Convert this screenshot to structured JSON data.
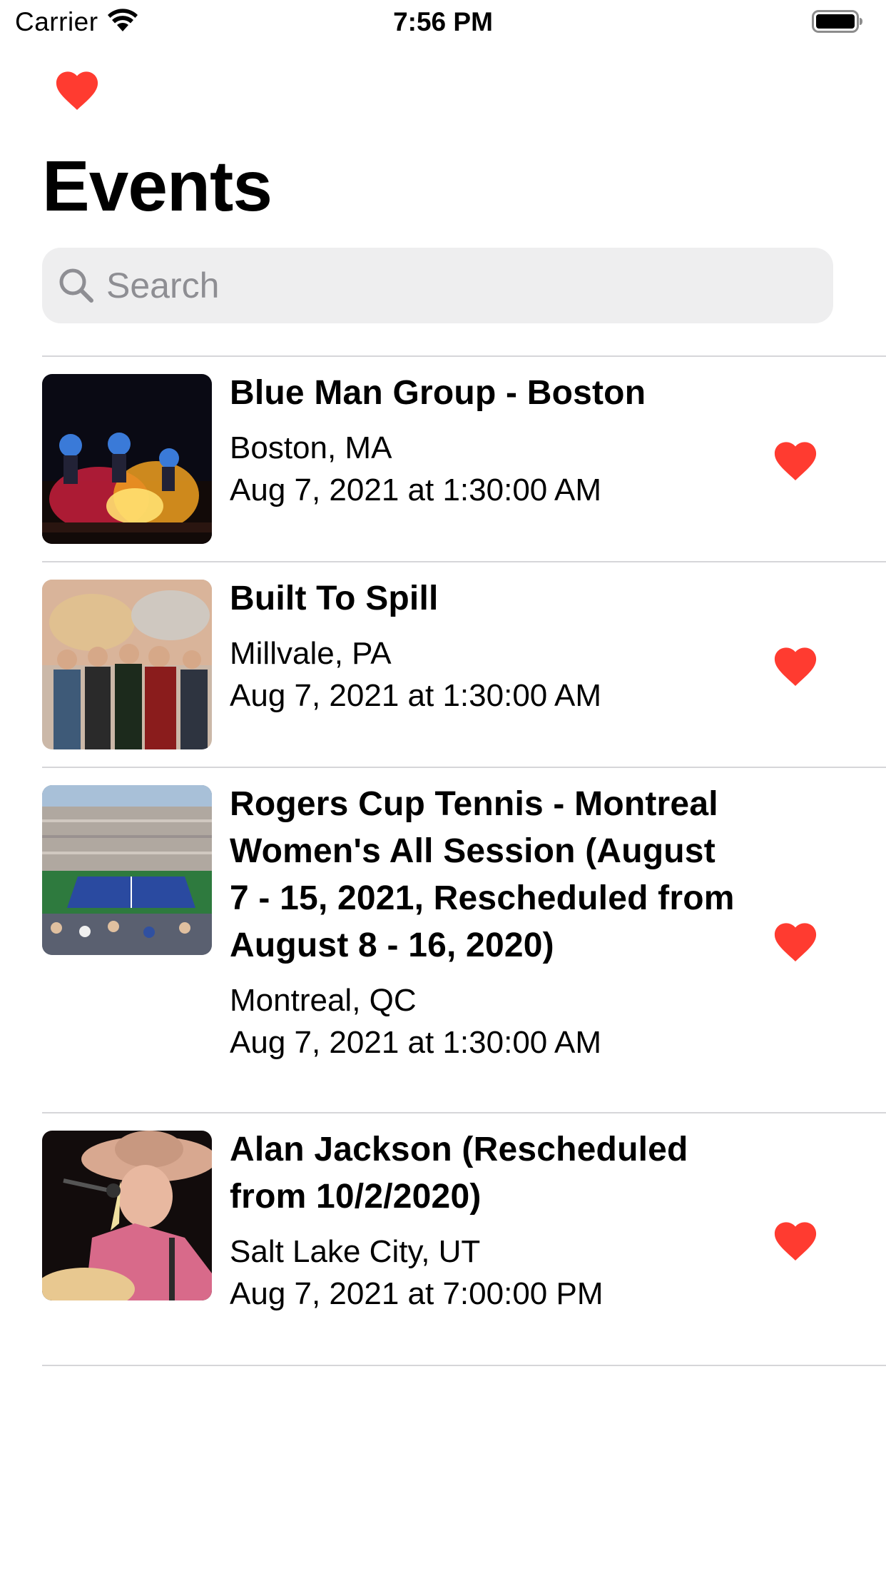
{
  "status_bar": {
    "carrier": "Carrier",
    "time": "7:56 PM"
  },
  "nav": {
    "title": "Events"
  },
  "search": {
    "placeholder": "Search",
    "value": ""
  },
  "colors": {
    "heart": "#ff3b30",
    "separator": "#d6d6d9",
    "search_background": "#eeeeef",
    "placeholder": "#8e8e93"
  },
  "events": [
    {
      "title": "Blue Man Group - Boston",
      "location": "Boston, MA",
      "date": "Aug 7, 2021 at 1:30:00 AM",
      "favorite": true
    },
    {
      "title": "Built To Spill",
      "location": "Millvale, PA",
      "date": "Aug 7, 2021 at 1:30:00 AM",
      "favorite": true
    },
    {
      "title": "Rogers Cup Tennis - Montreal Women's All Session (August 7 - 15, 2021, Rescheduled from August 8 - 16, 2020)",
      "location": "Montreal, QC",
      "date": "Aug 7, 2021 at 1:30:00 AM",
      "favorite": true
    },
    {
      "title": "Alan Jackson (Rescheduled from 10/2/2020)",
      "location": "Salt Lake City, UT",
      "date": "Aug 7, 2021 at 7:00:00 PM",
      "favorite": true
    }
  ]
}
